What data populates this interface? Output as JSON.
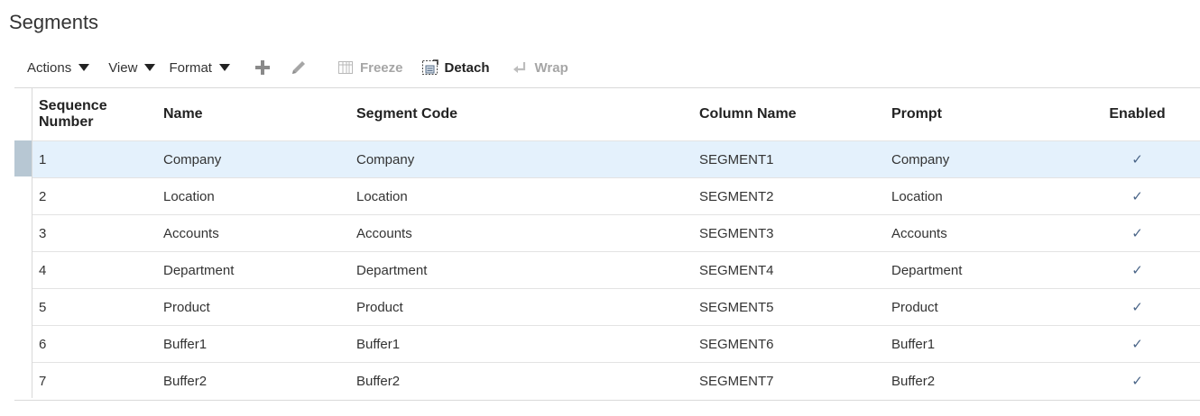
{
  "page": {
    "title": "Segments"
  },
  "toolbar": {
    "actions_label": "Actions",
    "view_label": "View",
    "format_label": "Format",
    "add_icon": "plus-icon",
    "edit_icon": "pencil-icon",
    "freeze_label": "Freeze",
    "detach_label": "Detach",
    "wrap_label": "Wrap"
  },
  "table": {
    "columns": {
      "sequence_number": "Sequence Number",
      "name": "Name",
      "segment_code": "Segment Code",
      "column_name": "Column Name",
      "prompt": "Prompt",
      "enabled": "Enabled"
    },
    "rows": [
      {
        "seq": "1",
        "name": "Company",
        "code": "Company",
        "column": "SEGMENT1",
        "prompt": "Company",
        "enabled": "✓"
      },
      {
        "seq": "2",
        "name": "Location",
        "code": "Location",
        "column": "SEGMENT2",
        "prompt": "Location",
        "enabled": "✓"
      },
      {
        "seq": "3",
        "name": "Accounts",
        "code": "Accounts",
        "column": "SEGMENT3",
        "prompt": "Accounts",
        "enabled": "✓"
      },
      {
        "seq": "4",
        "name": "Department",
        "code": "Department",
        "column": "SEGMENT4",
        "prompt": "Department",
        "enabled": "✓"
      },
      {
        "seq": "5",
        "name": "Product",
        "code": "Product",
        "column": "SEGMENT5",
        "prompt": "Product",
        "enabled": "✓"
      },
      {
        "seq": "6",
        "name": "Buffer1",
        "code": "Buffer1",
        "column": "SEGMENT6",
        "prompt": "Buffer1",
        "enabled": "✓"
      },
      {
        "seq": "7",
        "name": "Buffer2",
        "code": "Buffer2",
        "column": "SEGMENT7",
        "prompt": "Buffer2",
        "enabled": "✓"
      }
    ],
    "selected_row": 0
  },
  "colors": {
    "selected_row_bg": "#e4f1fc",
    "selector_active": "#b7c7d3",
    "check": "#4a6588",
    "disabled_text": "#a6a6a6"
  }
}
